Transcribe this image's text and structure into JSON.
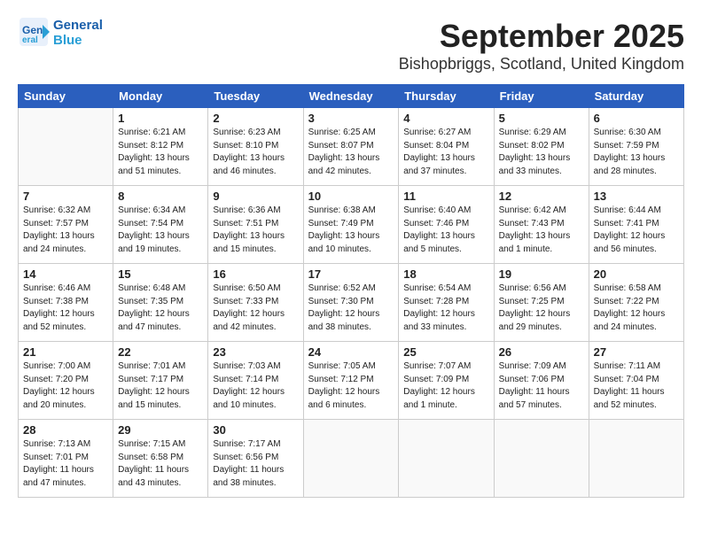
{
  "header": {
    "month_year": "September 2025",
    "location": "Bishopbriggs, Scotland, United Kingdom"
  },
  "logo": {
    "text_general": "General",
    "text_blue": "Blue"
  },
  "columns": [
    "Sunday",
    "Monday",
    "Tuesday",
    "Wednesday",
    "Thursday",
    "Friday",
    "Saturday"
  ],
  "weeks": [
    [
      {
        "day": "",
        "info": ""
      },
      {
        "day": "1",
        "info": "Sunrise: 6:21 AM\nSunset: 8:12 PM\nDaylight: 13 hours\nand 51 minutes."
      },
      {
        "day": "2",
        "info": "Sunrise: 6:23 AM\nSunset: 8:10 PM\nDaylight: 13 hours\nand 46 minutes."
      },
      {
        "day": "3",
        "info": "Sunrise: 6:25 AM\nSunset: 8:07 PM\nDaylight: 13 hours\nand 42 minutes."
      },
      {
        "day": "4",
        "info": "Sunrise: 6:27 AM\nSunset: 8:04 PM\nDaylight: 13 hours\nand 37 minutes."
      },
      {
        "day": "5",
        "info": "Sunrise: 6:29 AM\nSunset: 8:02 PM\nDaylight: 13 hours\nand 33 minutes."
      },
      {
        "day": "6",
        "info": "Sunrise: 6:30 AM\nSunset: 7:59 PM\nDaylight: 13 hours\nand 28 minutes."
      }
    ],
    [
      {
        "day": "7",
        "info": "Sunrise: 6:32 AM\nSunset: 7:57 PM\nDaylight: 13 hours\nand 24 minutes."
      },
      {
        "day": "8",
        "info": "Sunrise: 6:34 AM\nSunset: 7:54 PM\nDaylight: 13 hours\nand 19 minutes."
      },
      {
        "day": "9",
        "info": "Sunrise: 6:36 AM\nSunset: 7:51 PM\nDaylight: 13 hours\nand 15 minutes."
      },
      {
        "day": "10",
        "info": "Sunrise: 6:38 AM\nSunset: 7:49 PM\nDaylight: 13 hours\nand 10 minutes."
      },
      {
        "day": "11",
        "info": "Sunrise: 6:40 AM\nSunset: 7:46 PM\nDaylight: 13 hours\nand 5 minutes."
      },
      {
        "day": "12",
        "info": "Sunrise: 6:42 AM\nSunset: 7:43 PM\nDaylight: 13 hours\nand 1 minute."
      },
      {
        "day": "13",
        "info": "Sunrise: 6:44 AM\nSunset: 7:41 PM\nDaylight: 12 hours\nand 56 minutes."
      }
    ],
    [
      {
        "day": "14",
        "info": "Sunrise: 6:46 AM\nSunset: 7:38 PM\nDaylight: 12 hours\nand 52 minutes."
      },
      {
        "day": "15",
        "info": "Sunrise: 6:48 AM\nSunset: 7:35 PM\nDaylight: 12 hours\nand 47 minutes."
      },
      {
        "day": "16",
        "info": "Sunrise: 6:50 AM\nSunset: 7:33 PM\nDaylight: 12 hours\nand 42 minutes."
      },
      {
        "day": "17",
        "info": "Sunrise: 6:52 AM\nSunset: 7:30 PM\nDaylight: 12 hours\nand 38 minutes."
      },
      {
        "day": "18",
        "info": "Sunrise: 6:54 AM\nSunset: 7:28 PM\nDaylight: 12 hours\nand 33 minutes."
      },
      {
        "day": "19",
        "info": "Sunrise: 6:56 AM\nSunset: 7:25 PM\nDaylight: 12 hours\nand 29 minutes."
      },
      {
        "day": "20",
        "info": "Sunrise: 6:58 AM\nSunset: 7:22 PM\nDaylight: 12 hours\nand 24 minutes."
      }
    ],
    [
      {
        "day": "21",
        "info": "Sunrise: 7:00 AM\nSunset: 7:20 PM\nDaylight: 12 hours\nand 20 minutes."
      },
      {
        "day": "22",
        "info": "Sunrise: 7:01 AM\nSunset: 7:17 PM\nDaylight: 12 hours\nand 15 minutes."
      },
      {
        "day": "23",
        "info": "Sunrise: 7:03 AM\nSunset: 7:14 PM\nDaylight: 12 hours\nand 10 minutes."
      },
      {
        "day": "24",
        "info": "Sunrise: 7:05 AM\nSunset: 7:12 PM\nDaylight: 12 hours\nand 6 minutes."
      },
      {
        "day": "25",
        "info": "Sunrise: 7:07 AM\nSunset: 7:09 PM\nDaylight: 12 hours\nand 1 minute."
      },
      {
        "day": "26",
        "info": "Sunrise: 7:09 AM\nSunset: 7:06 PM\nDaylight: 11 hours\nand 57 minutes."
      },
      {
        "day": "27",
        "info": "Sunrise: 7:11 AM\nSunset: 7:04 PM\nDaylight: 11 hours\nand 52 minutes."
      }
    ],
    [
      {
        "day": "28",
        "info": "Sunrise: 7:13 AM\nSunset: 7:01 PM\nDaylight: 11 hours\nand 47 minutes."
      },
      {
        "day": "29",
        "info": "Sunrise: 7:15 AM\nSunset: 6:58 PM\nDaylight: 11 hours\nand 43 minutes."
      },
      {
        "day": "30",
        "info": "Sunrise: 7:17 AM\nSunset: 6:56 PM\nDaylight: 11 hours\nand 38 minutes."
      },
      {
        "day": "",
        "info": ""
      },
      {
        "day": "",
        "info": ""
      },
      {
        "day": "",
        "info": ""
      },
      {
        "day": "",
        "info": ""
      }
    ]
  ]
}
